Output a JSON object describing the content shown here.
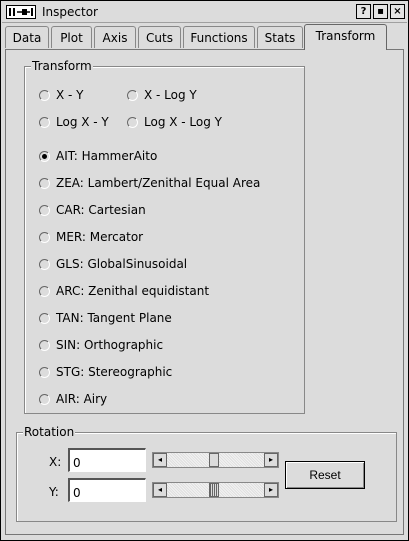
{
  "window": {
    "title": "Inspector",
    "controls": {
      "help": "?",
      "maximize": "▪",
      "close": "×"
    }
  },
  "tabs": [
    {
      "label": "Data"
    },
    {
      "label": "Plot"
    },
    {
      "label": "Axis"
    },
    {
      "label": "Cuts"
    },
    {
      "label": "Functions"
    },
    {
      "label": "Stats"
    },
    {
      "label": "Transform",
      "active": true
    }
  ],
  "transform": {
    "legend": "Transform",
    "options": [
      {
        "label": "X - Y",
        "selected": false
      },
      {
        "label": "X - Log Y",
        "selected": false
      },
      {
        "label": "Log X - Y",
        "selected": false
      },
      {
        "label": "Log X - Log Y",
        "selected": false
      },
      {
        "label": "AIT: HammerAito",
        "selected": true
      },
      {
        "label": "ZEA: Lambert/Zenithal Equal Area",
        "selected": false
      },
      {
        "label": "CAR: Cartesian",
        "selected": false
      },
      {
        "label": "MER: Mercator",
        "selected": false
      },
      {
        "label": "GLS: GlobalSinusoidal",
        "selected": false
      },
      {
        "label": "ARC: Zenithal equidistant",
        "selected": false
      },
      {
        "label": "TAN: Tangent Plane",
        "selected": false
      },
      {
        "label": "SIN: Orthographic",
        "selected": false
      },
      {
        "label": "STG: Stereographic",
        "selected": false
      },
      {
        "label": "AIR: Airy",
        "selected": false
      }
    ]
  },
  "rotation": {
    "legend": "Rotation",
    "x_label": "X:",
    "x_value": "0",
    "y_label": "Y:",
    "y_value": "0",
    "reset_label": "Reset"
  },
  "icons": {
    "app": "inspector-app-icon",
    "scroll_left": "◂",
    "scroll_right": "▸"
  }
}
